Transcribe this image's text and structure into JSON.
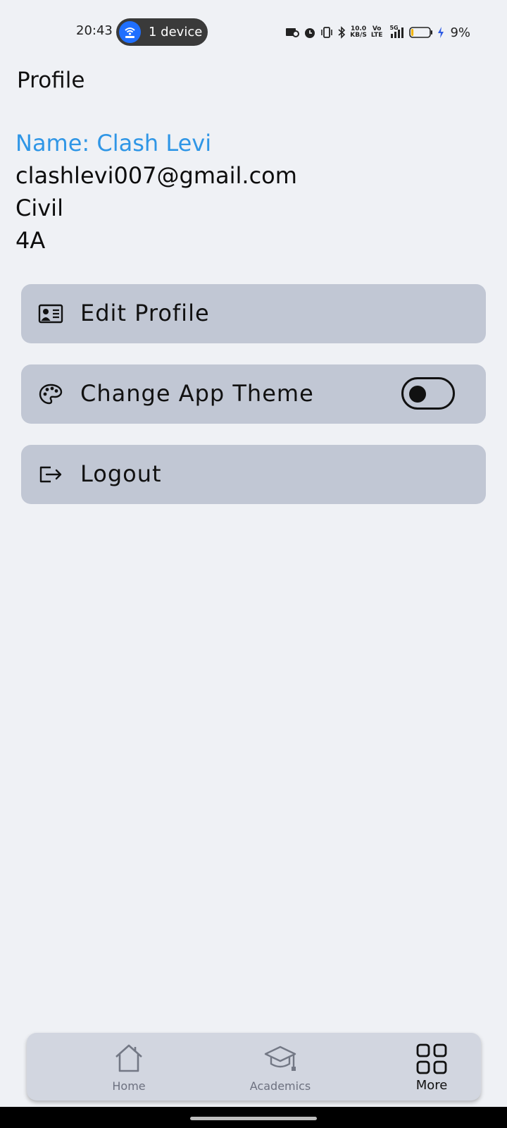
{
  "status_bar": {
    "time": "20:43",
    "hotspot_label": "1 device",
    "net_speed_value": "10.0",
    "net_speed_unit": "KB/S",
    "volte_top": "Vo",
    "volte_bottom": "LTE",
    "network_type": "5G",
    "battery_percent": "9%",
    "battery_level": 0.09,
    "icons": [
      "screen-record-icon",
      "alarm-icon",
      "vibrate-icon",
      "bluetooth-icon",
      "signal-icon",
      "battery-icon",
      "charging-icon"
    ]
  },
  "header": {
    "title": "Profile"
  },
  "profile": {
    "name": "Name: Clash Levi",
    "email": "clashlevi007@gmail.com",
    "department": "Civil",
    "section": "4A"
  },
  "menu": {
    "edit_profile": "Edit Profile",
    "change_theme": "Change App Theme",
    "logout": "Logout",
    "theme_toggle_on": false
  },
  "bottom_nav": {
    "home": "Home",
    "academics": "Academics",
    "more": "More",
    "active": "More"
  },
  "colors": {
    "background": "#eff1f5",
    "card": "#c1c7d4",
    "name_accent": "#2f96e6",
    "nav_bg": "#d2d6e0",
    "hotspot_blue": "#1f6fff"
  }
}
